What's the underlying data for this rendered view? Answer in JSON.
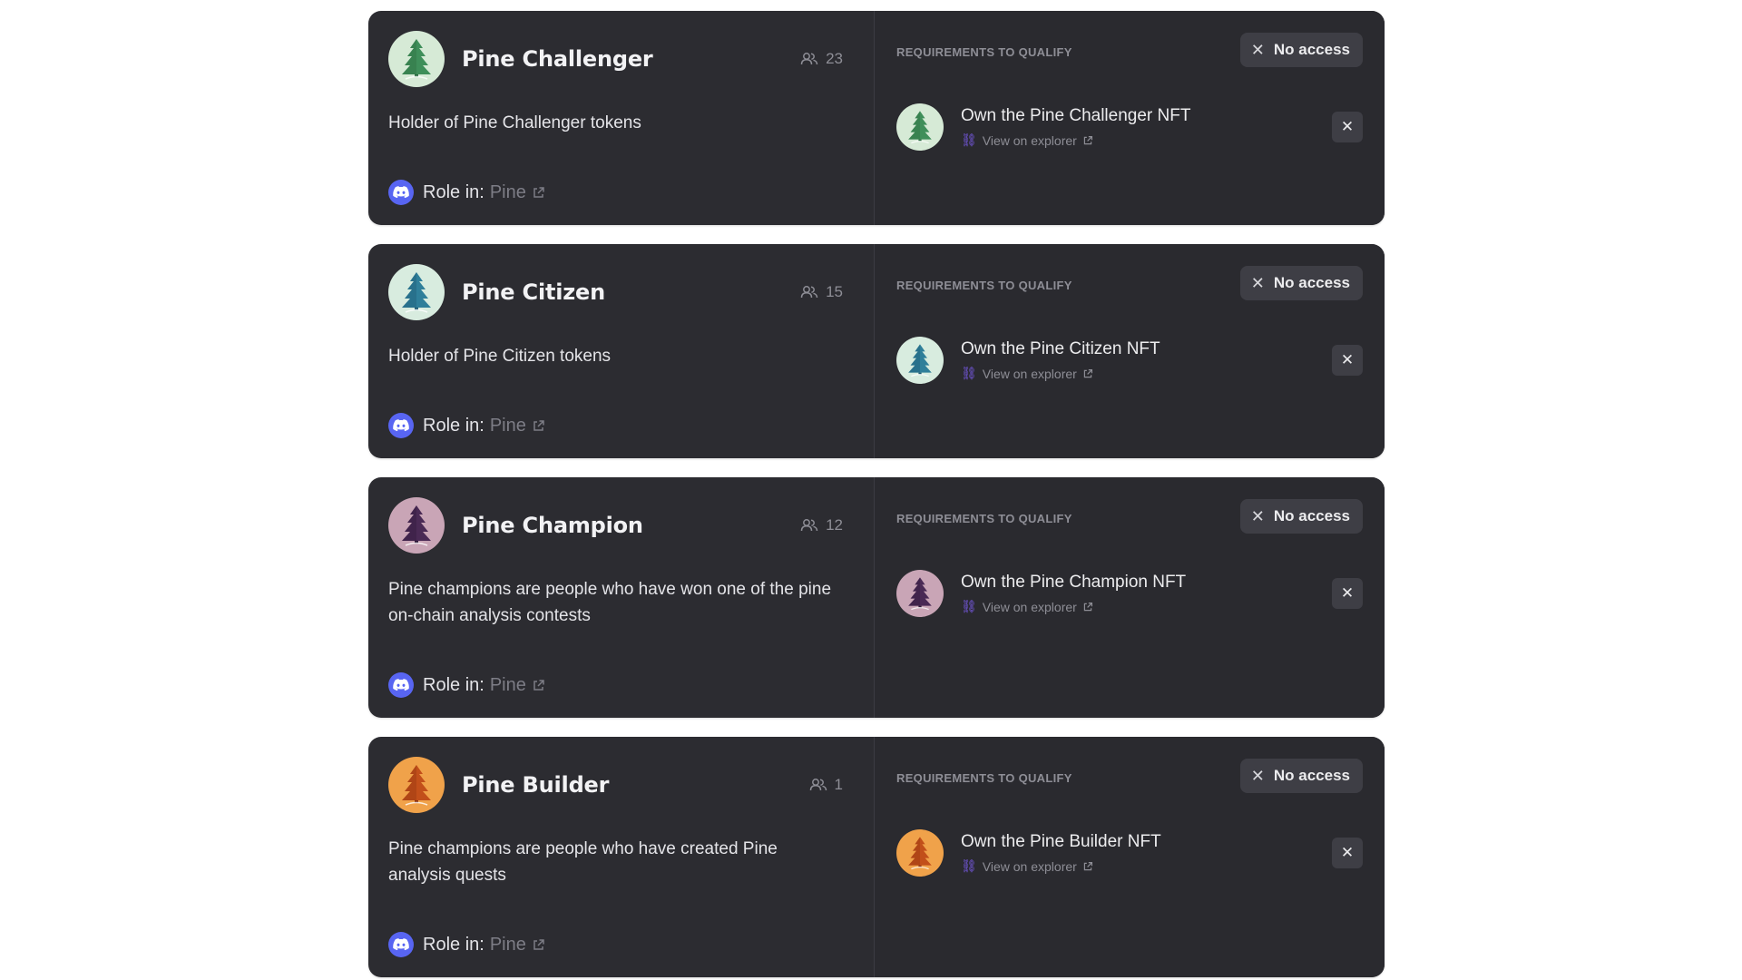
{
  "roles": [
    {
      "name": "Pine Challenger",
      "members": "23",
      "description": "Holder of Pine Challenger tokens",
      "role_in_label": "Role in:",
      "guild_name": "Pine",
      "requirements_title": "REQUIREMENTS TO QUALIFY",
      "access_label": "No access",
      "requirement": {
        "label": "Own the Pine Challenger NFT",
        "explorer_label": "View on explorer"
      },
      "avatar_bg": "#d6ead6",
      "tree_color": "#3f8f5a",
      "tree_color_dark": "#2a6b40"
    },
    {
      "name": "Pine Citizen",
      "members": "15",
      "description": "Holder of Pine Citizen tokens",
      "role_in_label": "Role in:",
      "guild_name": "Pine",
      "requirements_title": "REQUIREMENTS TO QUALIFY",
      "access_label": "No access",
      "requirement": {
        "label": "Own the Pine Citizen NFT",
        "explorer_label": "View on explorer"
      },
      "avatar_bg": "#d8ecdf",
      "tree_color": "#2f7f9a",
      "tree_color_dark": "#1e5a72"
    },
    {
      "name": "Pine Champion",
      "members": "12",
      "description": "Pine champions are people who have won one of the pine on-chain analysis contests",
      "role_in_label": "Role in:",
      "guild_name": "Pine",
      "requirements_title": "REQUIREMENTS TO QUALIFY",
      "access_label": "No access",
      "requirement": {
        "label": "Own the Pine Champion NFT",
        "explorer_label": "View on explorer"
      },
      "avatar_bg": "#c9a5b6",
      "tree_color": "#4a2a55",
      "tree_color_dark": "#2e1838"
    },
    {
      "name": "Pine Builder",
      "members": "1",
      "description": "Pine champions are people who have created Pine analysis quests",
      "role_in_label": "Role in:",
      "guild_name": "Pine",
      "requirements_title": "REQUIREMENTS TO QUALIFY",
      "access_label": "No access",
      "requirement": {
        "label": "Own the Pine Builder NFT",
        "explorer_label": "View on explorer"
      },
      "avatar_bg": "#f0a24a",
      "tree_color": "#c24f1a",
      "tree_color_dark": "#8f3510"
    }
  ]
}
